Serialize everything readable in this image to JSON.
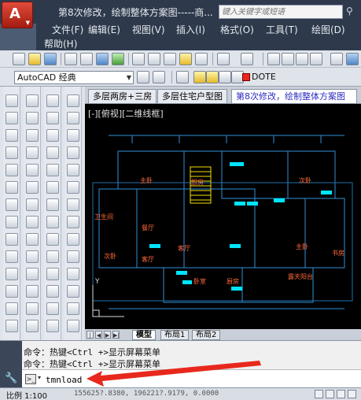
{
  "titlebar": {
    "title": "第8次修改，绘制整体方案图-----商...",
    "search_placeholder": "键入关键字或短语"
  },
  "menu": {
    "items": [
      "文件(F)",
      "编辑(E)",
      "视图(V)",
      "插入(I)",
      "格式(O)",
      "工具(T)",
      "绘图(D)",
      "帮助(H)"
    ]
  },
  "toolbar": {
    "workspace": "AutoCAD 经典",
    "linetype": "DOTE"
  },
  "doc_tabs": [
    "多层两房+三房",
    "多层住宅户型图",
    "第8次修改，绘制整体方案图"
  ],
  "canvas": {
    "view_label": "[-][俯视][二维线框]",
    "rooms": [
      "主卧",
      "厨房",
      "次卧",
      "卫生间",
      "餐厅",
      "客厅",
      "客厅",
      "次卧",
      "主卧",
      "书房",
      "卧室",
      "厨房",
      "露天阳台"
    ]
  },
  "layout_tabs": [
    "模型",
    "布局1",
    "布局2"
  ],
  "command": {
    "history": [
      "命令：热键<Ctrl +>显示屏幕菜单",
      "命令：热键<Ctrl +>显示屏幕菜单"
    ],
    "input_value": "tmnload"
  },
  "status": {
    "scale": "比例 1:100",
    "coords": "155625?.8380, 196221?.9179, 0.0000"
  },
  "colors": {
    "app_button": "#c8301e",
    "canvas_bg": "#000000",
    "annotation_arrow": "#e8281c"
  }
}
